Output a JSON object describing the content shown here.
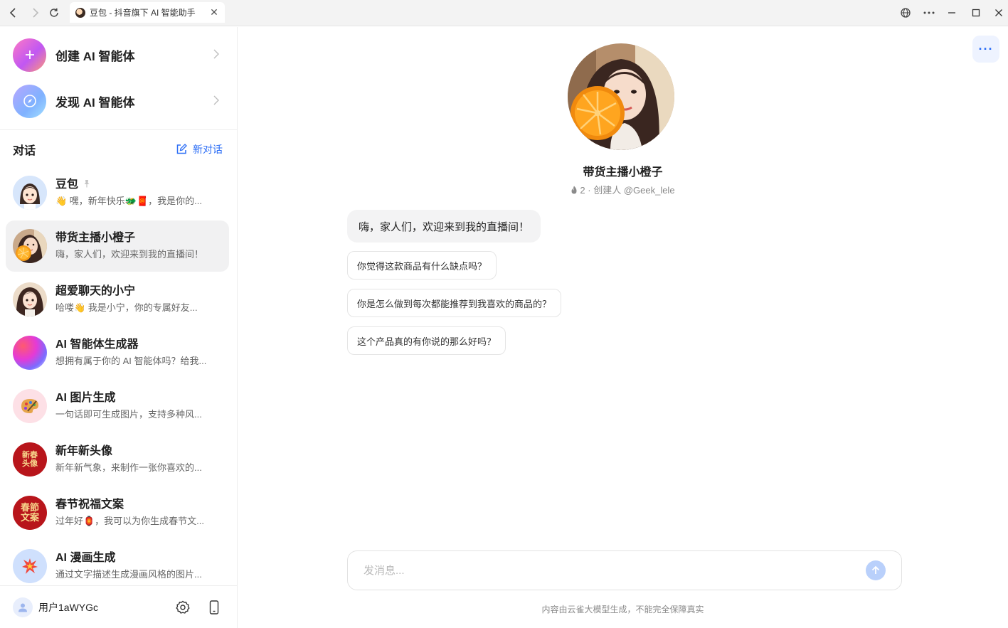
{
  "window": {
    "tab_title": "豆包 - 抖音旗下 AI 智能助手",
    "tab_close": "✕"
  },
  "sidebar": {
    "top_items": [
      {
        "label": "创建 AI 智能体",
        "icon": "plus-icon"
      },
      {
        "label": "发现 AI 智能体",
        "icon": "compass-icon"
      }
    ],
    "section_title": "对话",
    "new_chat_label": "新对话",
    "conversations": [
      {
        "name": "豆包",
        "preview": "👋 嘿，新年快乐🐲🧧，我是你的...",
        "pinned": true,
        "avatar": "doubao-avatar"
      },
      {
        "name": "带货主播小橙子",
        "preview": "嗨，家人们，欢迎来到我的直播间！",
        "active": true,
        "avatar": "orange-girl-avatar"
      },
      {
        "name": "超爱聊天的小宁",
        "preview": "哈喽👋 我是小宁，你的专属好友...",
        "avatar": "xiaoning-avatar"
      },
      {
        "name": "AI 智能体生成器",
        "preview": "想拥有属于你的 AI 智能体吗？给我...",
        "avatar": "gradient-orb-avatar"
      },
      {
        "name": "AI 图片生成",
        "preview": "一句话即可生成图片，支持多种风...",
        "avatar": "palette-avatar"
      },
      {
        "name": "新年新头像",
        "preview": "新年新气象，来制作一张你喜欢的...",
        "avatar": "new-year-avatar",
        "avatar_text": "新春\n头像"
      },
      {
        "name": "春节祝福文案",
        "preview": "过年好🏮，我可以为你生成春节文...",
        "avatar": "spring-festival-avatar",
        "avatar_text": "春節\n文案"
      },
      {
        "name": "AI 漫画生成",
        "preview": "通过文字描述生成漫画风格的图片...",
        "avatar": "comic-avatar"
      }
    ],
    "footer": {
      "username": "用户1aWYGc"
    }
  },
  "main": {
    "bot_name": "带货主播小橙子",
    "bot_meta": "2 · 创建人 @Geek_lele",
    "greeting": "嗨，家人们，欢迎来到我的直播间！",
    "suggestions": [
      "你觉得这款商品有什么缺点吗？",
      "你是怎么做到每次都能推荐到我喜欢的商品的？",
      "这个产品真的有你说的那么好吗？"
    ],
    "input_placeholder": "发消息...",
    "disclaimer": "内容由云雀大模型生成，不能完全保障真实",
    "more_label": "···"
  },
  "colors": {
    "accent": "#2c6ef6",
    "active_row": "#f1f1f2",
    "send_disabled": "#b9d0fb"
  }
}
